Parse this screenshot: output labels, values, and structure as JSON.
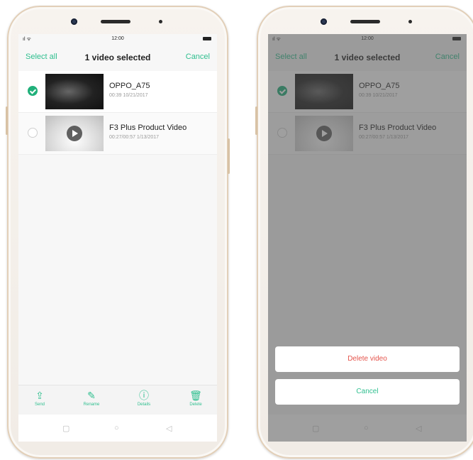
{
  "status": {
    "time": "12:00",
    "signal": "ıl ᯤ"
  },
  "header": {
    "select_all": "Select all",
    "title": "1 video selected",
    "cancel": "Cancel"
  },
  "videos": [
    {
      "title": "OPPO_A75",
      "meta": "00:39   10/21/2017",
      "selected": true
    },
    {
      "title": "F3 Plus Product Video",
      "meta": "00:27/00:57   1/13/2017",
      "selected": false
    }
  ],
  "toolbar": {
    "send": "Send",
    "rename": "Rename",
    "details": "Details",
    "delete": "Delete"
  },
  "dialog": {
    "delete_video": "Delete video",
    "cancel": "Cancel"
  },
  "icons": {
    "send": "share-icon",
    "rename": "pencil-icon",
    "details": "info-icon",
    "delete": "trash-icon"
  },
  "colors": {
    "accent": "#2fbf8f",
    "danger": "#e5534b"
  }
}
